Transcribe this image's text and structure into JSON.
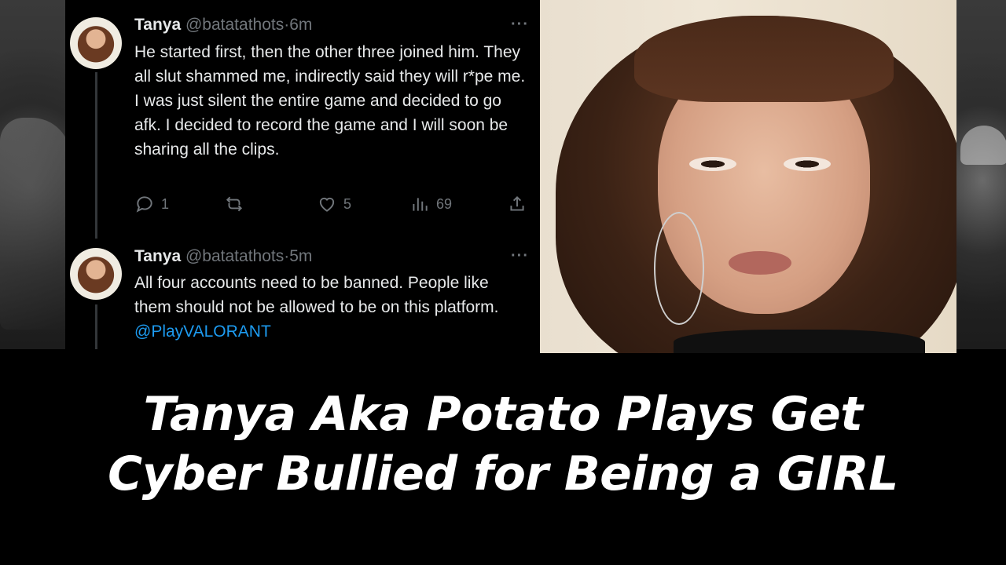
{
  "tweets": [
    {
      "name": "Tanya",
      "handle": "@batatathots",
      "separator": "·",
      "time": "6m",
      "more": "···",
      "text": "He started first, then the other three joined him. They all slut shammed me, indirectly said they will r*pe me. I was just silent the entire game and decided to go afk. I decided to record the game and I will soon be sharing all the clips.",
      "actions": {
        "reply_count": "1",
        "retweet_count": "",
        "like_count": "5",
        "views_count": "69"
      }
    },
    {
      "name": "Tanya",
      "handle": "@batatathots",
      "separator": "·",
      "time": "5m",
      "more": "···",
      "text": "All four accounts need to be banned. People like them should not be allowed to be on this platform. ",
      "mention": "@PlayVALORANT"
    }
  ],
  "headline": {
    "line1": "Tanya Aka Potato Plays Get",
    "line2": "Cyber Bullied for Being a GIRL"
  },
  "colors": {
    "tweet_text": "#e7e9ea",
    "muted": "#71767b",
    "link": "#1d9bf0",
    "background": "#000000"
  }
}
